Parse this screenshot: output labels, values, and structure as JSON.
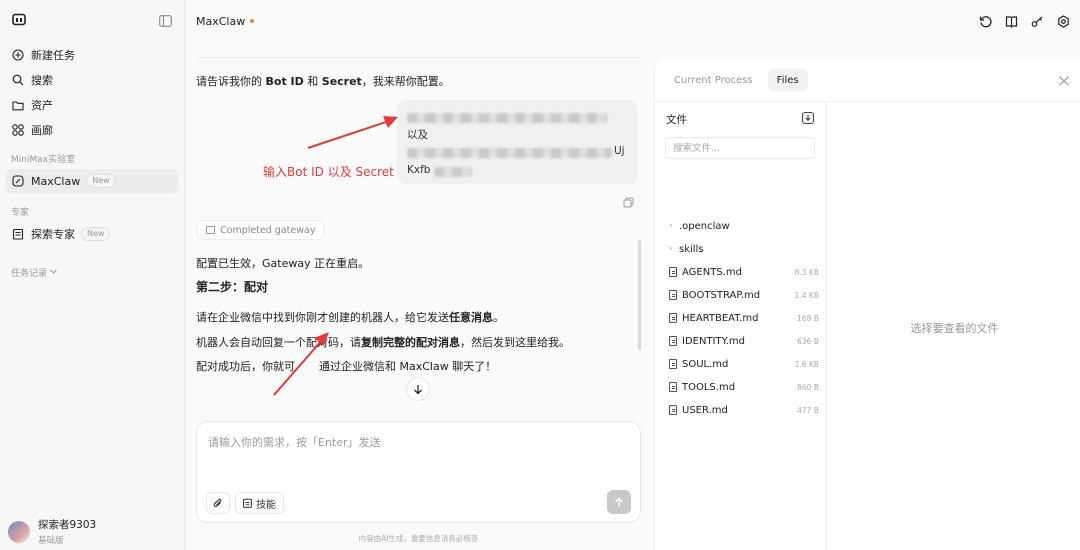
{
  "sidebar": {
    "items": [
      {
        "label": "新建任务",
        "icon": "plus-circle-icon"
      },
      {
        "label": "搜索",
        "icon": "search-icon"
      },
      {
        "label": "资产",
        "icon": "folder-icon"
      },
      {
        "label": "画廊",
        "icon": "grid-icon"
      }
    ],
    "section_lab": "MiniMax实验室",
    "maxclaw": {
      "label": "MaxClaw",
      "badge": "New"
    },
    "section_expert": "专家",
    "explorer": {
      "label": "探索专家",
      "badge": "New"
    },
    "history_label": "任务记录",
    "user": {
      "name": "探索者9303",
      "plan": "基础版"
    }
  },
  "header": {
    "title": "MaxClaw",
    "status_color": "#f08a24"
  },
  "chat": {
    "request": {
      "pre": "请告诉我你的 ",
      "bot_id": "Bot ID",
      "mid": " 和 ",
      "secret": "Secret",
      "post": "，我来帮你配置。"
    },
    "bubble": {
      "and": "以及",
      "partial_1": "Uj",
      "partial_2": "Kxfb"
    },
    "annotation_1": "输入Bot ID 以及 Secret",
    "gateway_label": "Completed gateway",
    "reply_1": "配置已生效，Gateway 正在重启。",
    "step2": "第二步：配对",
    "reply_2": {
      "pre": "请在企业微信中找到你刚才创建的机器人，给它发送",
      "bold": "任意消息",
      "post": "。"
    },
    "reply_3": {
      "pre": "机器人会自动回复一个配对码，请",
      "bold": "复制完整的配对消息",
      "post": "，然后发到这里给我。"
    },
    "reply_4": {
      "pre": "配对成功后，你就可",
      "post": "通过企业微信和 MaxClaw 聊天了！"
    },
    "input_placeholder": "请输入你的需求，按「Enter」发送",
    "skill_label": "技能",
    "disclaimer": "内容由AI生成，重要信息请务必核查"
  },
  "panel": {
    "tabs": [
      {
        "label": "Current Process"
      },
      {
        "label": "Files"
      }
    ],
    "files_title": "文件",
    "search_placeholder": "搜索文件...",
    "folders": [
      {
        "name": ".openclaw"
      },
      {
        "name": "skills"
      }
    ],
    "files": [
      {
        "name": "AGENTS.md",
        "size": "8.3 KB"
      },
      {
        "name": "BOOTSTRAP.md",
        "size": "1.4 KB"
      },
      {
        "name": "HEARTBEAT.md",
        "size": "168 B"
      },
      {
        "name": "IDENTITY.md",
        "size": "636 B"
      },
      {
        "name": "SOUL.md",
        "size": "1.6 KB"
      },
      {
        "name": "TOOLS.md",
        "size": "860 B"
      },
      {
        "name": "USER.md",
        "size": "477 B"
      }
    ],
    "viewer_empty": "选择要查看的文件"
  }
}
